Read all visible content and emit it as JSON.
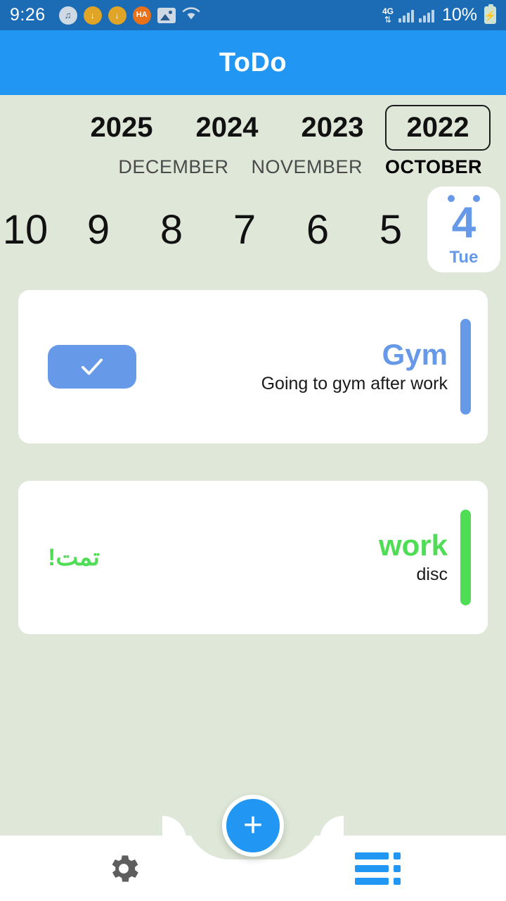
{
  "status_bar": {
    "time": "9:26",
    "icons": [
      "music-icon",
      "download-icon",
      "download-icon",
      "ha-badge-icon",
      "image-icon",
      "wifi-icon"
    ],
    "ha_label": "HA",
    "network_type": "4G",
    "battery_percent": "10%",
    "battery_state": "charging"
  },
  "app_bar": {
    "title": "ToDo"
  },
  "calendar": {
    "years": [
      {
        "label": "2025",
        "selected": false
      },
      {
        "label": "2024",
        "selected": false
      },
      {
        "label": "2023",
        "selected": false
      },
      {
        "label": "2022",
        "selected": true
      }
    ],
    "months": [
      {
        "label": "DECEMBER",
        "selected": false
      },
      {
        "label": "NOVEMBER",
        "selected": false
      },
      {
        "label": "OCTOBER",
        "selected": true
      }
    ],
    "days": [
      {
        "label": "10",
        "selected": false
      },
      {
        "label": "9",
        "selected": false
      },
      {
        "label": "8",
        "selected": false
      },
      {
        "label": "7",
        "selected": false
      },
      {
        "label": "6",
        "selected": false
      },
      {
        "label": "5",
        "selected": false
      },
      {
        "label": "4",
        "selected": true,
        "weekday": "Tue"
      }
    ]
  },
  "tasks": [
    {
      "title": "Gym",
      "subtitle": "Going to gym after work",
      "accent_color": "#6699e8",
      "left_control": "checkbox",
      "checked": true
    },
    {
      "title": "work",
      "subtitle": "disc",
      "accent_color": "#4fdd56",
      "left_control": "done-label",
      "done_label": "تمت!"
    }
  ],
  "fab": {
    "label": "+",
    "color": "#2196f3"
  },
  "bottom_nav": {
    "items": [
      {
        "icon": "gear-icon",
        "color": "#5e5e5e"
      },
      {
        "icon": "list-icon",
        "color": "#2196f3"
      }
    ]
  },
  "colors": {
    "background": "#dfe8d8",
    "app_bar": "#2196f3",
    "status_bar": "#1b6cb5",
    "accent_blue": "#6699e8",
    "accent_green": "#4fdd56"
  }
}
